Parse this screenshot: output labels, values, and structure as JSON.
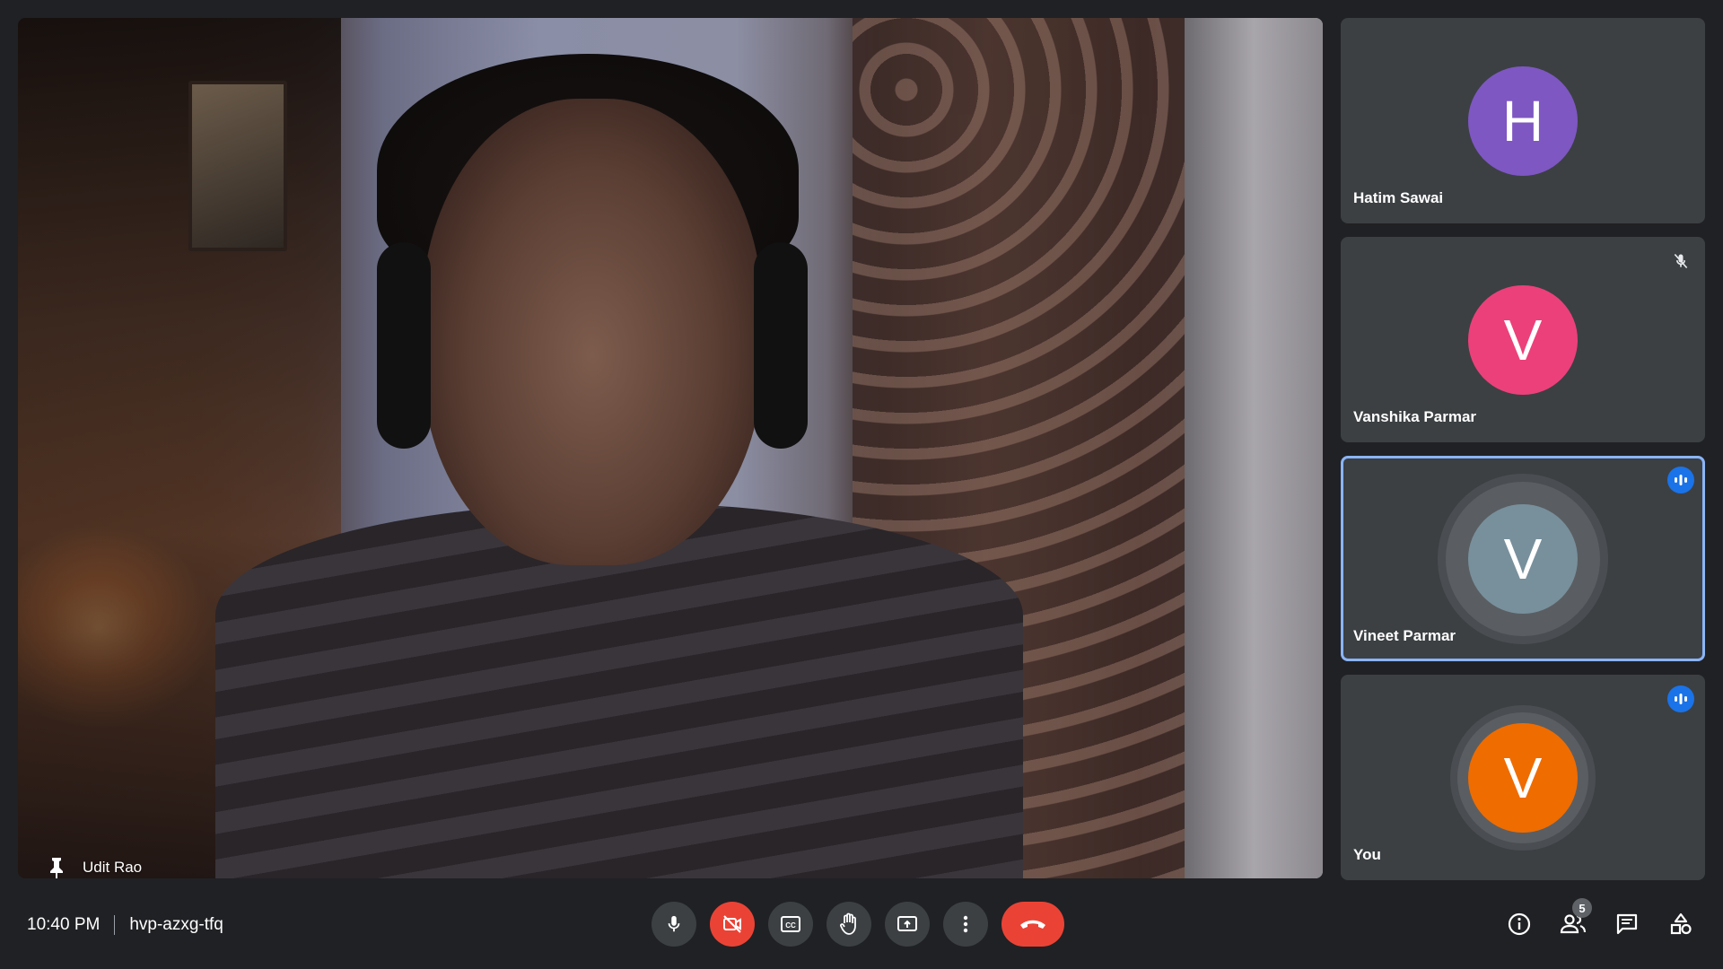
{
  "main_video": {
    "participant_name": "Udit Rao",
    "pin_icon": "pin-icon"
  },
  "participants": [
    {
      "name": "Hatim Sawai",
      "initial": "H",
      "color": "#7e57c2",
      "status": "none"
    },
    {
      "name": "Vanshika Parmar",
      "initial": "V",
      "color": "#ec407a",
      "status": "muted"
    },
    {
      "name": "Vineet Parmar",
      "initial": "V",
      "color": "#78909c",
      "status": "speaking"
    },
    {
      "name": "You",
      "initial": "V",
      "color": "#ef6c00",
      "status": "speaking"
    }
  ],
  "meeting": {
    "time": "10:40 PM",
    "code": "hvp-azxg-tfq"
  },
  "controls": {
    "mic_icon": "microphone-icon",
    "camera_icon": "camera-off-icon",
    "captions_icon": "closed-captions-icon",
    "hand_icon": "raise-hand-icon",
    "present_icon": "present-screen-icon",
    "more_icon": "more-options-icon",
    "end_icon": "end-call-icon"
  },
  "side_panel": {
    "people_count": "5",
    "icons": [
      "info-icon",
      "people-icon",
      "chat-icon",
      "activities-icon"
    ]
  },
  "colors": {
    "background": "#202124",
    "tile": "#3c4043",
    "accent": "#8ab4f8",
    "danger": "#ea4335",
    "badge_blue": "#1a73e8"
  }
}
